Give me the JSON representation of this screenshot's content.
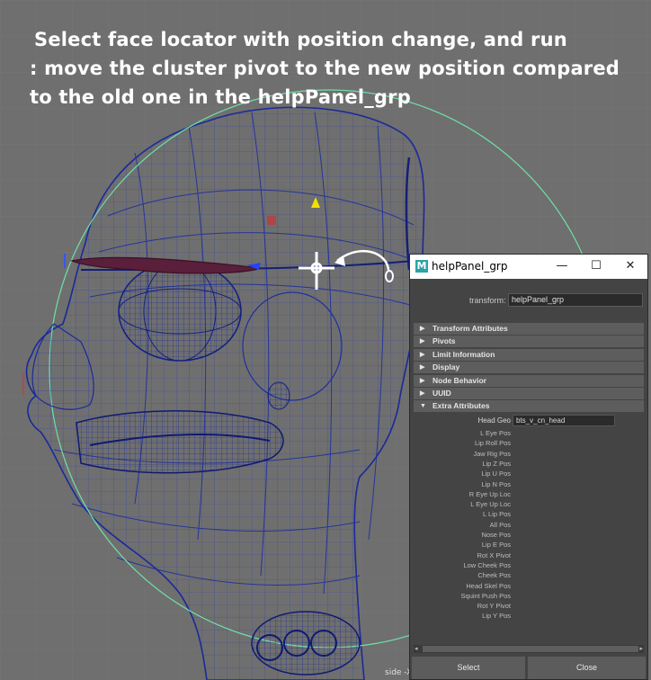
{
  "instruction": {
    "line1": "Select face locator with position change, and run",
    "line2": ": move the cluster pivot to the new position compared",
    "line3": "to the old one in the helpPanel_grp"
  },
  "viewport": {
    "side_label": "side -X"
  },
  "window": {
    "app_icon": "M",
    "title": "helpPanel_grp",
    "minimize_glyph": "—",
    "maximize_glyph": "☐",
    "close_glyph": "✕",
    "transform_label": "transform:",
    "transform_value": "helpPanel_grp",
    "sections": [
      {
        "label": "Transform Attributes",
        "expanded": false
      },
      {
        "label": "Pivots",
        "expanded": false
      },
      {
        "label": "Limit Information",
        "expanded": false
      },
      {
        "label": "Display",
        "expanded": false
      },
      {
        "label": "Node Behavior",
        "expanded": false
      },
      {
        "label": "UUID",
        "expanded": false
      },
      {
        "label": "Extra Attributes",
        "expanded": true
      }
    ],
    "head_geo": {
      "label": "Head Geo",
      "value": "bts_v_cn_head"
    },
    "extra_attributes": [
      "L Eye Pos",
      "Lip Roll Pos",
      "Jaw Rig Pos",
      "Lip Z Pos",
      "Lip U Pos",
      "Lip N Pos",
      "R Eye Up Loc",
      "L Eye Up Loc",
      "L Lip Pos",
      "All Pos",
      "Nose Pos",
      "Lip E Pos",
      "Rot X Pivot",
      "Low Cheek Pos",
      "Cheek Pos",
      "Head Skel Pos",
      "Squint Push Pos",
      "Rot Y Pivot",
      "Lip Y Pos"
    ],
    "select_label": "Select",
    "close_label": "Close"
  },
  "colors": {
    "wire": "#1e2f9e",
    "wire_dark": "#142070",
    "eyebrow": "#5a1f3a",
    "sphere_guide": "#6fe0a8",
    "locator": "#ffffff",
    "window_bg": "#444444",
    "section_bg": "#5d5d5d",
    "field_bg": "#2b2b2b",
    "maya_icon": "#2aa3a6"
  }
}
